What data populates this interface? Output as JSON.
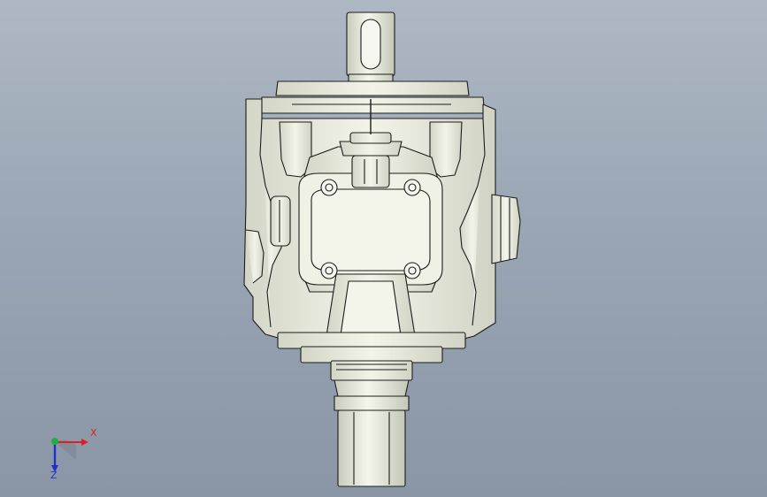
{
  "app": {
    "type": "cad-graphics-viewport",
    "view": "front"
  },
  "model": {
    "body_color": "#e9ecde",
    "shadow_color": "#c9ccbd",
    "edge_color": "#1c1c1c"
  },
  "triad": {
    "x_label": "X",
    "z_label": "Z",
    "x_color": "#e02020",
    "y_color": "#20b040",
    "z_color": "#2030d0"
  }
}
